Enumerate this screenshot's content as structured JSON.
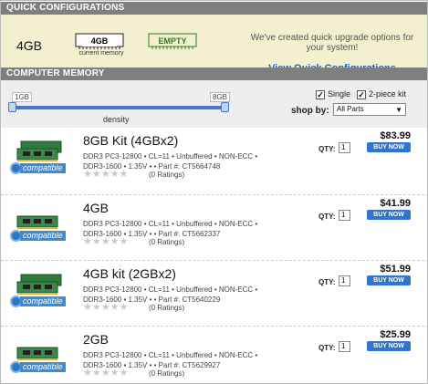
{
  "quick_config": {
    "header": "QUICK CONFIGURATIONS",
    "current_size": "4GB",
    "slot1_label": "4GB",
    "slot1_sub": "current memory",
    "slot2_label": "EMPTY",
    "promo_text": "We've created quick upgrade options for your system!",
    "link_label": "View Quick Configurations"
  },
  "computer_memory": {
    "header": "COMPUTER MEMORY",
    "slider_min": "1GB",
    "slider_max": "8GB",
    "slider_label": "density",
    "single_label": "Single",
    "two_piece_label": "2-piece kit",
    "single_checked": true,
    "two_piece_checked": true,
    "shop_by_label": "shop by:",
    "shop_by_value": "All Parts"
  },
  "compatible_badge": "compatible",
  "qty_label": "QTY:",
  "buy_label": "BUY NOW",
  "products": [
    {
      "title": "8GB Kit (4GBx2)",
      "desc1": "DDR3 PC3-12800 • CL=11 • Unbuffered • NON-ECC •",
      "desc2": "DDR3-1600 • 1.35V • • Part #: CT5664748",
      "stars": "★★★★★",
      "ratings": "(0 Ratings)",
      "price": "$83.99",
      "qty": "1",
      "sticks": 2
    },
    {
      "title": "4GB",
      "desc1": "DDR3 PC3-12800 • CL=11 • Unbuffered • NON-ECC •",
      "desc2": "DDR3-1600 • 1.35V • • Part #: CT5662337",
      "stars": "★★★★★",
      "ratings": "(0 Ratings)",
      "price": "$41.99",
      "qty": "1",
      "sticks": 1
    },
    {
      "title": "4GB kit (2GBx2)",
      "desc1": "DDR3 PC3-12800 • CL=11 • Unbuffered • NON-ECC •",
      "desc2": "DDR3-1600 • 1.35V • • Part #: CT5640229",
      "stars": "★★★★★",
      "ratings": "(0 Ratings)",
      "price": "$51.99",
      "qty": "1",
      "sticks": 2
    },
    {
      "title": "2GB",
      "desc1": "DDR3 PC3-12800 • CL=11 • Unbuffered • NON-ECC •",
      "desc2": "DDR3-1600 • 1.35V • • Part #: CT5629927",
      "stars": "★★★★★",
      "ratings": "(0 Ratings)",
      "price": "$25.99",
      "qty": "1",
      "sticks": 1
    }
  ]
}
